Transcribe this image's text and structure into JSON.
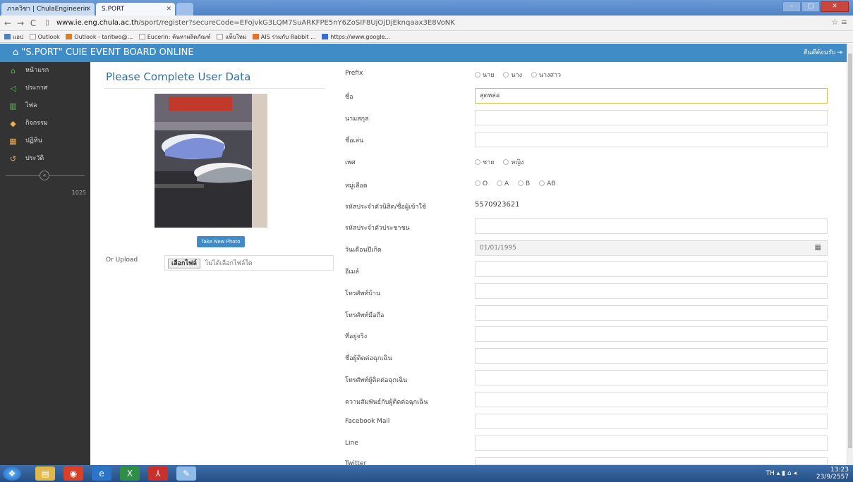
{
  "browser": {
    "tabs": [
      {
        "label": "ภาควิชา | ChulaEngineerin"
      },
      {
        "label": "S.PORT"
      }
    ],
    "url_host": "www.ie.eng.chula.ac.th",
    "url_path": "/sport/register?secureCode=EFojvkG3LQM7SuARKFPE5nY6ZoSIF8UjOjDjEknqaax3E8VoNK",
    "bookmarks": [
      "แอป",
      "Outlook",
      "Outlook - taritwo@...",
      "Eucerin: ค้นหาผลิตภัณฑ์",
      "แท็บใหม่",
      "AIS ร่วมกับ Rabbit ...",
      "https://www.google..."
    ]
  },
  "app": {
    "title": "\"S.PORT\" CUIE EVENT BOARD ONLINE",
    "login_label": "ยินดีต้อนรับ"
  },
  "sidebar": {
    "items": [
      {
        "label": "หน้าแรก",
        "icon": "home-icon",
        "color": "#5cb85c"
      },
      {
        "label": "ประกาศ",
        "icon": "megaphone-icon",
        "color": "#5cb85c"
      },
      {
        "label": "ไฟล",
        "icon": "chart-icon",
        "color": "#5cb85c"
      },
      {
        "label": "กิจกรรม",
        "icon": "car-icon",
        "color": "#f0ad4e"
      },
      {
        "label": "ปฏิทิน",
        "icon": "calendar-icon",
        "color": "#f0ad4e"
      },
      {
        "label": "ประวัติ",
        "icon": "history-icon",
        "color": "#f0ad4e"
      }
    ],
    "counter": "1025"
  },
  "page": {
    "title": "Please Complete User Data",
    "take_photo": "Take New Photo",
    "or_upload": "Or Upload",
    "file_button": "เลือกไฟล์",
    "file_status": "ไม่ได้เลือกไฟล์ใด"
  },
  "form": {
    "prefix": {
      "label": "Prefix",
      "options": [
        "นาย",
        "นาง",
        "นางสาว"
      ]
    },
    "first_name": {
      "label": "ชื่อ",
      "value": "สุดหล่อ"
    },
    "last_name": {
      "label": "นามสกุล",
      "value": ""
    },
    "nickname": {
      "label": "ชื่อเล่น",
      "value": ""
    },
    "gender": {
      "label": "เพศ",
      "options": [
        "ชาย",
        "หญิง"
      ]
    },
    "blood": {
      "label": "หมู่เลือด",
      "options": [
        "O",
        "A",
        "B",
        "AB"
      ]
    },
    "student_id": {
      "label": "รหัสประจำตัวนิสิต/ชื่อผู้เข้าใช้",
      "value": "5570923621"
    },
    "citizen_id": {
      "label": "รหัสประจำตัวประชาชน",
      "value": ""
    },
    "birthdate": {
      "label": "วันเดือนปีเกิด",
      "value": "01/01/1995"
    },
    "email": {
      "label": "อีเมล์",
      "value": ""
    },
    "home_phone": {
      "label": "โทรศัพท์บ้าน",
      "value": ""
    },
    "mobile": {
      "label": "โทรศัพท์มือถือ",
      "value": ""
    },
    "address": {
      "label": "ที่อยู่จริง",
      "value": ""
    },
    "emergency_name": {
      "label": "ชื่อผู้ติดต่อฉุกเฉิน",
      "value": ""
    },
    "emergency_phone": {
      "label": "โทรศัพท์ผู้ติดต่อฉุกเฉิน",
      "value": ""
    },
    "emergency_relation": {
      "label": "ความสัมพันธ์กับผู้ติดต่อฉุกเฉิน",
      "value": ""
    },
    "facebook": {
      "label": "Facebook Mail",
      "value": ""
    },
    "line": {
      "label": "Line",
      "value": ""
    },
    "twitter": {
      "label": "Twitter",
      "value": ""
    }
  },
  "taskbar": {
    "lang": "TH",
    "time": "13:23",
    "date": "23/9/2557"
  }
}
